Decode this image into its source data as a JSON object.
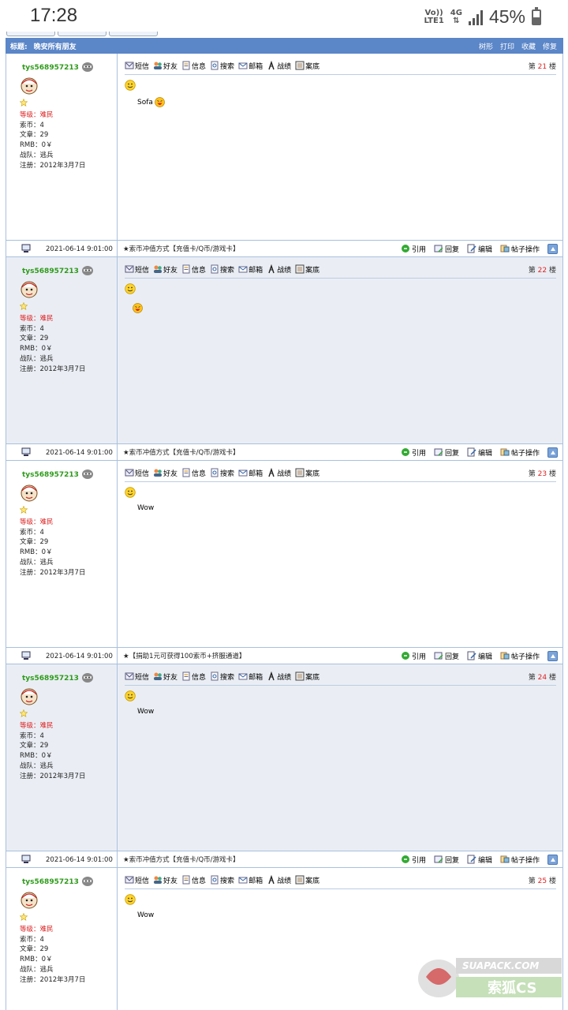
{
  "status_bar": {
    "time": "17:28",
    "volte": "Vo))",
    "lte": "LTE1",
    "net": "4G",
    "battery": "45%",
    "battery_level": 0.45
  },
  "thread": {
    "title_label": "标题:",
    "title": "晚安所有朋友",
    "actions": [
      "树形",
      "打印",
      "收藏",
      "修复"
    ]
  },
  "toolbar_items": [
    {
      "label": "短信",
      "icon": "sms-icon"
    },
    {
      "label": "好友",
      "icon": "friends-icon"
    },
    {
      "label": "信息",
      "icon": "info-icon"
    },
    {
      "label": "搜索",
      "icon": "search-icon"
    },
    {
      "label": "邮箱",
      "icon": "mail-icon"
    },
    {
      "label": "战绩",
      "icon": "record-icon"
    },
    {
      "label": "案底",
      "icon": "file-icon"
    }
  ],
  "footer_actions": [
    {
      "label": "引用",
      "icon": "quote-icon"
    },
    {
      "label": "回复",
      "icon": "reply-icon"
    },
    {
      "label": "编辑",
      "icon": "edit-icon"
    },
    {
      "label": "帖子操作",
      "icon": "post-ops-icon"
    }
  ],
  "floor_prefix": "第",
  "floor_suffix": "楼",
  "colors": {
    "title_bar": "#5b86c8",
    "username": "#2e9a1a",
    "rank": "#d22222",
    "floor_number": "#e02020",
    "alt_post_bg": "#eaeef4"
  },
  "posts": [
    {
      "username": "tys568957213",
      "rank": "等级：难民",
      "coins": "索币：4",
      "articles": "文章：29",
      "rmb": "RMB：0￥",
      "team": "战队：逃兵",
      "registered": "注册：2012年3月7日",
      "floor": "21",
      "message": "Sofa",
      "emoji": true,
      "date": "2021-06-14 9:01:00",
      "notice": "★索币冲值方式【充值卡/Q币/游戏卡】"
    },
    {
      "username": "tys568957213",
      "rank": "等级：难民",
      "coins": "索币：4",
      "articles": "文章：29",
      "rmb": "RMB：0￥",
      "team": "战队：逃兵",
      "registered": "注册：2012年3月7日",
      "floor": "22",
      "message": "",
      "emoji": true,
      "date": "2021-06-14 9:01:00",
      "notice": "★索币冲值方式【充值卡/Q币/游戏卡】"
    },
    {
      "username": "tys568957213",
      "rank": "等级：难民",
      "coins": "索币：4",
      "articles": "文章：29",
      "rmb": "RMB：0￥",
      "team": "战队：逃兵",
      "registered": "注册：2012年3月7日",
      "floor": "23",
      "message": "Wow",
      "emoji": false,
      "date": "2021-06-14 9:01:00",
      "notice": "★【捐助1元可获得100索币+挤服通道】"
    },
    {
      "username": "tys568957213",
      "rank": "等级：难民",
      "coins": "索币：4",
      "articles": "文章：29",
      "rmb": "RMB：0￥",
      "team": "战队：逃兵",
      "registered": "注册：2012年3月7日",
      "floor": "24",
      "message": "Wow",
      "emoji": false,
      "date": "2021-06-14 9:01:00",
      "notice": "★索币冲值方式【充值卡/Q币/游戏卡】"
    },
    {
      "username": "tys568957213",
      "rank": "等级：难民",
      "coins": "索币：4",
      "articles": "文章：29",
      "rmb": "RMB：0￥",
      "team": "战队：逃兵",
      "registered": "注册：2012年3月7日",
      "floor": "25",
      "message": "Wow",
      "emoji": false,
      "date": "",
      "notice": ""
    }
  ],
  "watermark": {
    "site": "SUAPACK.COM",
    "brand": "索狐CS"
  }
}
